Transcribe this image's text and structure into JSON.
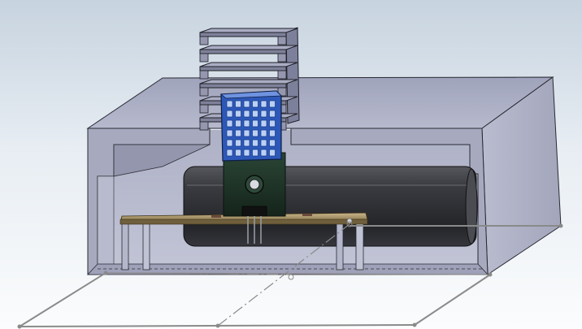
{
  "viewport": {
    "view_type": "cad-3d-viewport",
    "background_top": "#c7d3df",
    "background_bottom": "#fbfcfd"
  },
  "model": {
    "enclosure_color": "#adb0c6",
    "sensor_cage_color": "#3f6fcf",
    "heatsink_color": "#8a8ea6",
    "board_color": "#1f3327",
    "strip_color": "#9c8a60",
    "battery_color": "#2e2f33",
    "sketch_line_color": "#8a8a8a"
  }
}
